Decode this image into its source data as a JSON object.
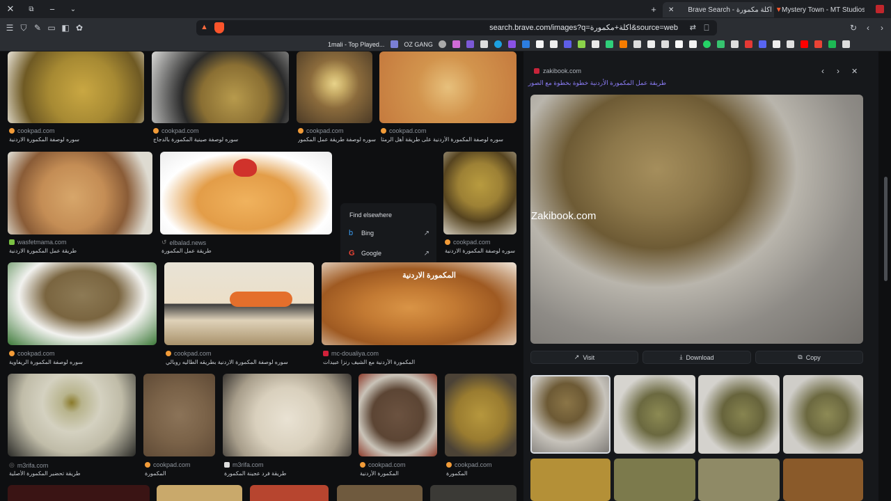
{
  "browser": {
    "tabs": [
      {
        "title": "Brave Search - اكلة مكمورة"
      },
      {
        "title": "Mystery Town - MT Studios | MTRP |"
      }
    ],
    "url": "search.brave.com/images?q=اكلة+مكمورة&source=web",
    "bookmarks": [
      "1mali - Top Played...",
      "OZ GANG"
    ]
  },
  "results": [
    {
      "source": "cookpad.com",
      "caption": "سوره لوصفة المكمورة الاردنية"
    },
    {
      "source": "cookpad.com",
      "caption": "سوره لوصفة صينية المكمورة بالدجاج"
    },
    {
      "source": "cookpad.com",
      "caption": "سوره لوصفة طريقة عمل المكمورة الاردنية"
    },
    {
      "source": "cookpad.com",
      "caption": "سوره لوصفة المكمورة الأردنية على طريقة أهل الرمثا"
    },
    {
      "source": "wasfetmama.com",
      "caption": "طريقة عمل المكمورة الاردنية"
    },
    {
      "source": "elbalad.news",
      "caption": "طريقة عمل المكمورة"
    },
    {
      "source": "cookpad.com",
      "caption": "سوره لوصفة المكمورة الاردنية"
    },
    {
      "source": "cookpad.com",
      "caption": "سوره لوصفة المكمورة الريفاوية"
    },
    {
      "source": "cookpad.com",
      "caption": "سوره لوصفة المكمورة الاردنية بطريقه الطاليه روبالي"
    },
    {
      "source": "mc-doualiya.com",
      "caption": "المكمورة الأردنية مع الشيف رنزا عبيدات"
    },
    {
      "source": "m3rifa.com",
      "caption": "طريقة تحضير المكمورة الأصلية"
    },
    {
      "source": "cookpad.com",
      "caption": "المكمورة"
    },
    {
      "source": "m3rifa.com",
      "caption": "طريقة فرد عجينة المكمورة"
    },
    {
      "source": "cookpad.com",
      "caption": "المكمورة الأردنية"
    },
    {
      "source": "cookpad.com",
      "caption": "المكمورة"
    }
  ],
  "find_elsewhere": {
    "title": "Find elsewhere",
    "engines": [
      {
        "name": "Bing"
      },
      {
        "name": "Google"
      }
    ]
  },
  "preview": {
    "source": "zakibook.com",
    "title": "طريقة عمل المكمورة الأردنية خطوة بخطوة مع الصور",
    "watermark": "Zakibook.com",
    "actions": {
      "visit": "Visit",
      "download": "Download",
      "copy": "Copy"
    }
  },
  "colors": {
    "accent": "#8b7cf6",
    "cookpad": "#f29b38"
  }
}
